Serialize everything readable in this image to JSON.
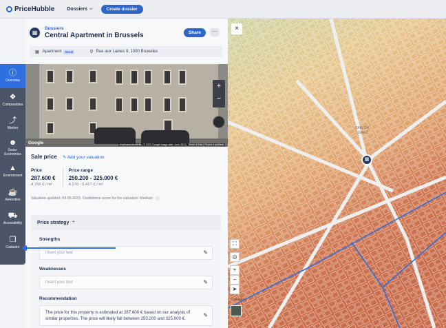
{
  "topbar": {
    "logo_text": "PriceHubble",
    "nav_dossiers": "Dossiers",
    "create_button": "Create dossier"
  },
  "header": {
    "breadcrumb": "Dossiers",
    "title": "Central Apartment in Brussels",
    "share_label": "Share",
    "more_label": "⋯",
    "property_type": "Apartment",
    "badge": "SALE",
    "address": "Rue aux Laines 9, 1000 Bruxelles"
  },
  "sidebar": {
    "items": [
      {
        "label": "Overview",
        "icon": "info-icon",
        "glyph": "ⓘ"
      },
      {
        "label": "Comparables",
        "icon": "tags-icon",
        "glyph": "❖"
      },
      {
        "label": "Market",
        "icon": "market-chart-icon",
        "glyph": "⤴"
      },
      {
        "label": "Socio-Economics",
        "icon": "people-icon",
        "glyph": "☻"
      },
      {
        "label": "Environment",
        "icon": "mountain-icon",
        "glyph": "▲"
      },
      {
        "label": "Amenities",
        "icon": "coffee-icon",
        "glyph": "☕"
      },
      {
        "label": "Accessibility",
        "icon": "car-icon",
        "glyph": "⛟"
      },
      {
        "label": "Cadastre",
        "icon": "layers-icon",
        "glyph": "❐"
      }
    ]
  },
  "photo": {
    "google_logo": "Google",
    "attribution": "Keyboard shortcuts  |  © 2023 Google  Image date: June 2021  |  Terms of Use  |  Report a problem",
    "zoom_in": "+",
    "zoom_out": "−"
  },
  "sale": {
    "title": "Sale price",
    "add_valuation": "Add your valuation",
    "price_label": "Price",
    "price_value": "287.600 €",
    "price_per_m2": "4.793 € / m²",
    "range_label": "Price range",
    "range_value": "250.200 - 325.000 €",
    "range_per_m2": "4.170 - 5.417 € / m²",
    "valuation_note": "Valuation updated: 03.05.2023. Confidence score for the valuation: Medium"
  },
  "strategy": {
    "title": "Price strategy",
    "strengths_label": "Strengths",
    "strengths_placeholder": "Insert your text",
    "weaknesses_label": "Weaknesses",
    "weaknesses_placeholder": "Insert your text",
    "recommendation_label": "Recommendation",
    "recommendation_text": "The price for this property is estimated at 287.600 € based on our analysis of similar properties. The price will likely fall between 250.200 and 325.000 €."
  },
  "map": {
    "close_label": "×",
    "sablon_label": "SABLON",
    "zavel_label": "ZAVEL",
    "mapbox_label": "© mapbox",
    "colors": {
      "north": "#cfd6a6",
      "mid": "#e2b685",
      "south": "#c96c4b",
      "route": "#2f6fe0"
    }
  }
}
